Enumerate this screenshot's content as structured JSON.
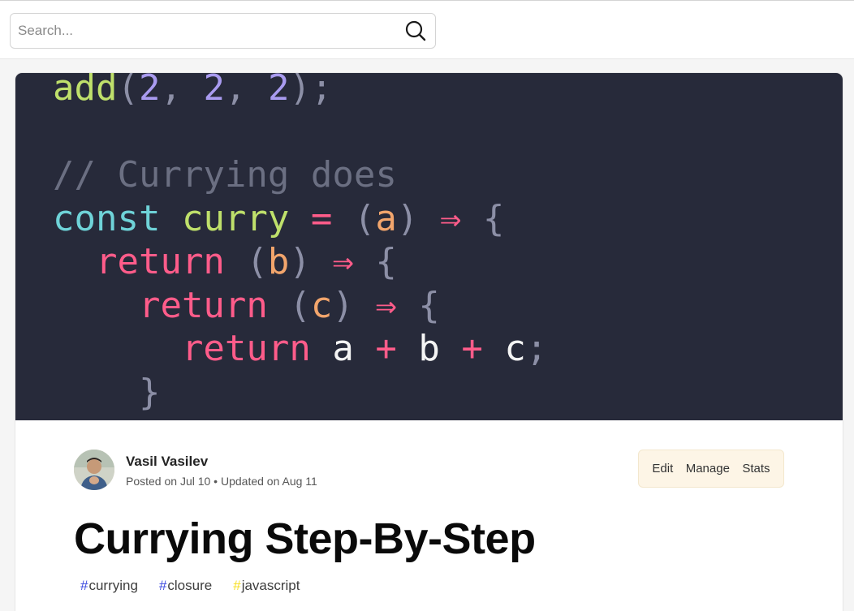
{
  "search": {
    "placeholder": "Search...",
    "value": ""
  },
  "cover": {
    "code_lines": [
      [
        {
          "t": "add",
          "c": "tok-fn"
        },
        {
          "t": "(",
          "c": "tok-punc"
        },
        {
          "t": "2",
          "c": "tok-num"
        },
        {
          "t": ", ",
          "c": "tok-punc"
        },
        {
          "t": "2",
          "c": "tok-num"
        },
        {
          "t": ", ",
          "c": "tok-punc"
        },
        {
          "t": "2",
          "c": "tok-num"
        },
        {
          "t": ");",
          "c": "tok-punc"
        }
      ],
      [],
      [
        {
          "t": "// Currying does",
          "c": "tok-comment"
        }
      ],
      [
        {
          "t": "const ",
          "c": "tok-kw"
        },
        {
          "t": "curry ",
          "c": "tok-var"
        },
        {
          "t": "= ",
          "c": "tok-op"
        },
        {
          "t": "(",
          "c": "tok-punc"
        },
        {
          "t": "a",
          "c": "tok-param"
        },
        {
          "t": ") ",
          "c": "tok-punc"
        },
        {
          "t": "⇒ ",
          "c": "tok-op"
        },
        {
          "t": "{",
          "c": "tok-punc"
        }
      ],
      [
        {
          "t": "  return ",
          "c": "tok-ret"
        },
        {
          "t": "(",
          "c": "tok-punc"
        },
        {
          "t": "b",
          "c": "tok-param"
        },
        {
          "t": ") ",
          "c": "tok-punc"
        },
        {
          "t": "⇒ ",
          "c": "tok-op"
        },
        {
          "t": "{",
          "c": "tok-punc"
        }
      ],
      [
        {
          "t": "    return ",
          "c": "tok-ret"
        },
        {
          "t": "(",
          "c": "tok-punc"
        },
        {
          "t": "c",
          "c": "tok-param"
        },
        {
          "t": ") ",
          "c": "tok-punc"
        },
        {
          "t": "⇒ ",
          "c": "tok-op"
        },
        {
          "t": "{",
          "c": "tok-punc"
        }
      ],
      [
        {
          "t": "      return ",
          "c": "tok-ret"
        },
        {
          "t": "a ",
          "c": "tok-id"
        },
        {
          "t": "+ ",
          "c": "tok-op"
        },
        {
          "t": "b ",
          "c": "tok-id"
        },
        {
          "t": "+ ",
          "c": "tok-op"
        },
        {
          "t": "c",
          "c": "tok-id"
        },
        {
          "t": ";",
          "c": "tok-punc"
        }
      ],
      [
        {
          "t": "    }",
          "c": "tok-punc"
        }
      ],
      [
        {
          "t": "  }",
          "c": "tok-punc"
        }
      ]
    ]
  },
  "author": {
    "name": "Vasil Vasilev",
    "dates": "Posted on Jul 10 • Updated on Aug 11"
  },
  "actions": {
    "edit": "Edit",
    "manage": "Manage",
    "stats": "Stats"
  },
  "article": {
    "title": "Currying Step-By-Step"
  },
  "tags": [
    {
      "hash": "#",
      "label": "currying",
      "color": "#3b49df"
    },
    {
      "hash": "#",
      "label": "closure",
      "color": "#3b49df"
    },
    {
      "hash": "#",
      "label": "javascript",
      "color": "#f7df1e"
    }
  ]
}
